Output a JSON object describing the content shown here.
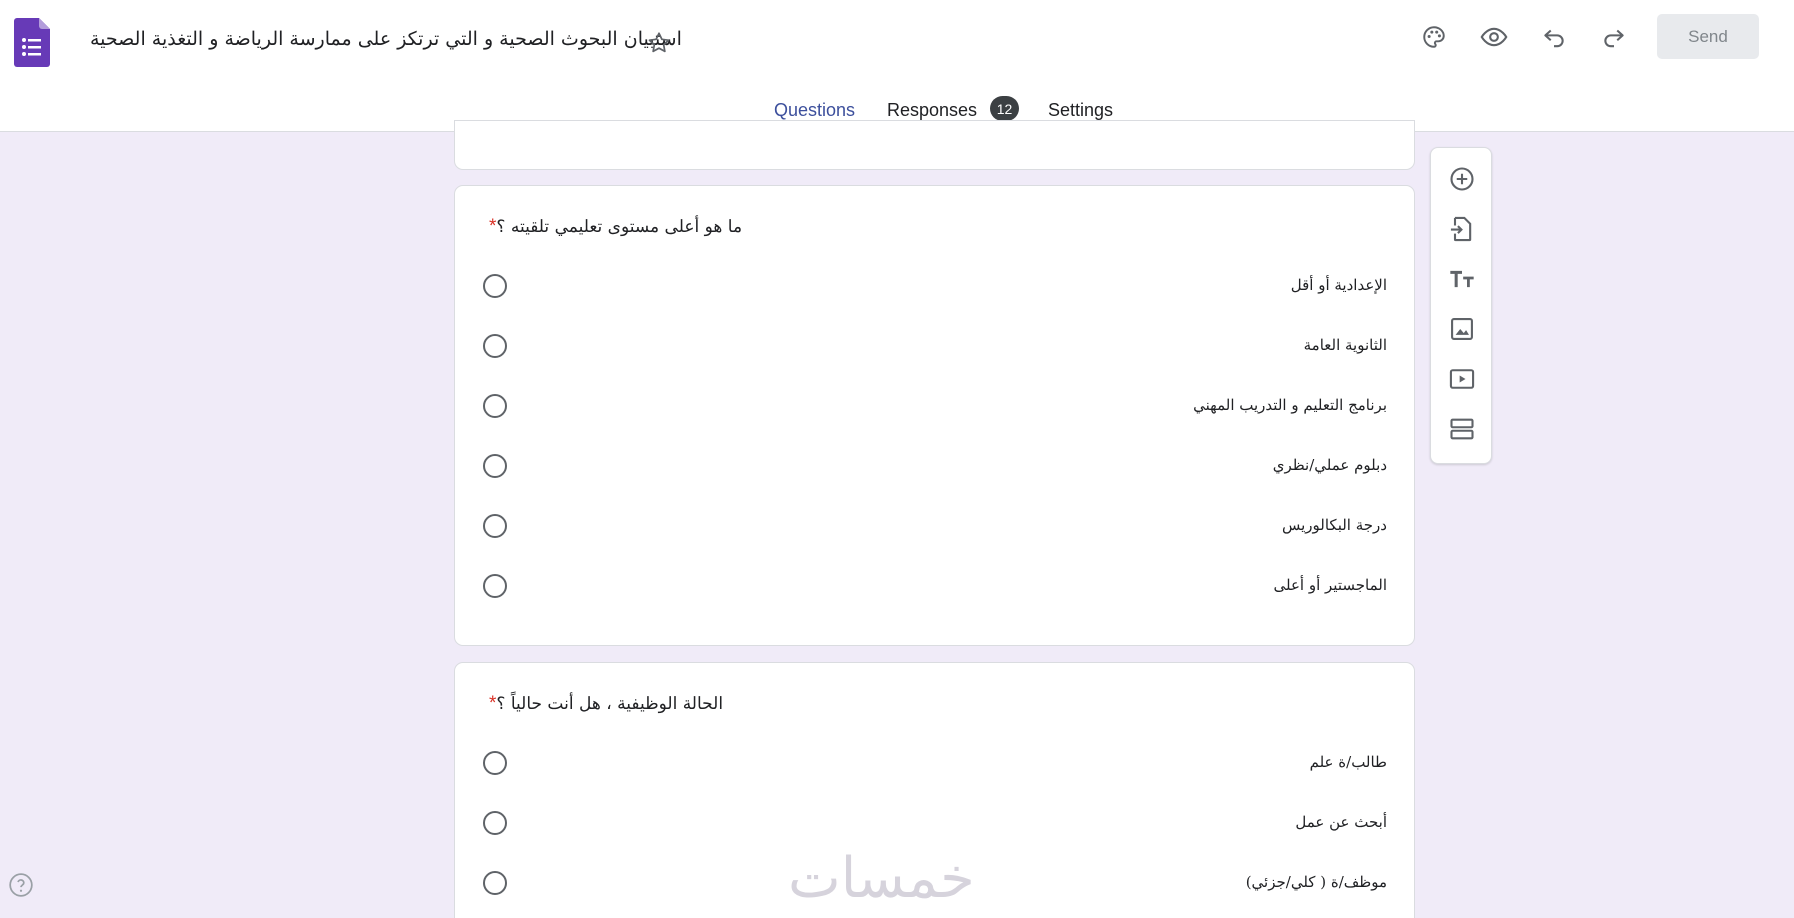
{
  "header": {
    "title": "استبيان البحوث الصحية و التي ترتكز على ممارسة الرياضة و التغذية الصحية",
    "send_label": "Send",
    "icons": [
      "palette-icon",
      "eye-icon",
      "undo-icon",
      "redo-icon",
      "star-icon"
    ]
  },
  "tabs": [
    {
      "label": "Questions",
      "active": true
    },
    {
      "label": "Responses",
      "badge": "12"
    },
    {
      "label": "Settings"
    }
  ],
  "questions": [
    {
      "title": "ما هو أعلى مستوى تعليمي تلقيته ؟",
      "required_mark": "*",
      "options": [
        "الإعدادية أو أقل",
        "الثانوية العامة",
        "برنامج التعليم و التدريب المهني",
        "دبلوم عملي/نظري",
        "درجة البكالوريس",
        "الماجستير أو أعلى"
      ]
    },
    {
      "title": "الحالة الوظيفية ، هل أنت حالياً ؟",
      "required_mark": "*",
      "options": [
        "طالب/ة علم",
        "أبحث عن عمل",
        "موظف/ة ( كلي/جزئي)"
      ]
    }
  ],
  "toolbar": [
    "add-question-icon",
    "import-questions-icon",
    "add-title-icon",
    "add-image-icon",
    "add-video-icon",
    "add-section-icon"
  ],
  "watermark": "خمسات",
  "colors": {
    "accent": "#3c4f9c",
    "background": "#f0ebf8",
    "app_icon": "#673ab7",
    "required": "#d93025"
  }
}
